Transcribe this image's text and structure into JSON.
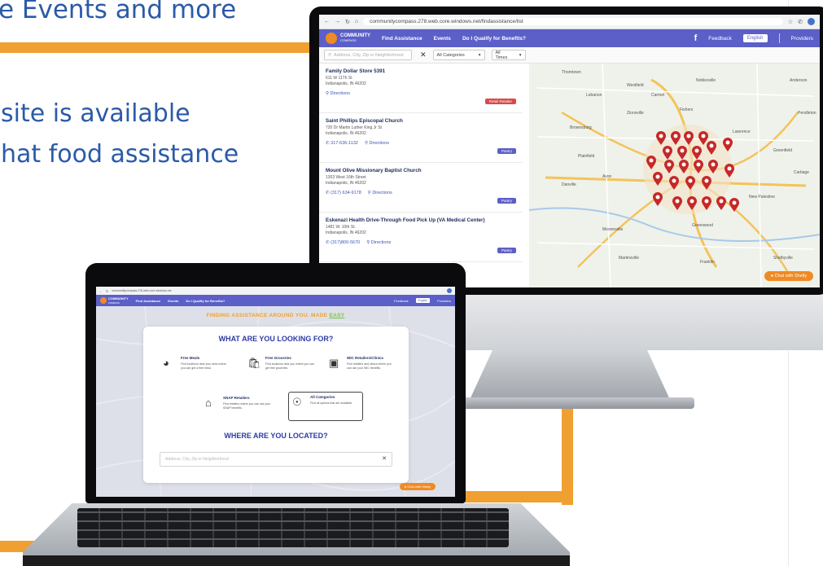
{
  "headline": {
    "line1": "e Events and more",
    "line2": "site is available",
    "line3": "hat food assistance"
  },
  "desktop": {
    "browser": {
      "url": "communitycompass.278.web.core.windows.net/findassistance/list"
    },
    "nav": {
      "logo_line1": "COMMUNITY",
      "logo_line2": "COMPASS",
      "links": [
        "Find Assistance",
        "Events",
        "Do I Qualify for Benefits?"
      ],
      "feedback": "Feedback",
      "language": "English",
      "providers": "Providers"
    },
    "filters": {
      "search_placeholder": "Address, City, Zip or Neighborhood",
      "category": "All Categories",
      "times": "All Times"
    },
    "results": [
      {
        "name": "Family Dollar Store 5391",
        "addr1": "611 W 11Th St",
        "addr2": "Indianapolis, IN 46202",
        "phone": "",
        "directions": "Directions",
        "tag": "Retail Retailer",
        "tag_color": "#d84a4a"
      },
      {
        "name": "Saint Phillips Episcopal Church",
        "addr1": "720 Dr Martin Luther King Jr St",
        "addr2": "Indianapolis, IN 46202",
        "phone": "317-636-1132",
        "directions": "Directions",
        "tag": "Pantry",
        "tag_color": "#5b5fc7"
      },
      {
        "name": "Mount Olive Missionary Baptist Church",
        "addr1": "1303 West 16th Street",
        "addr2": "Indianapolis, IN 46202",
        "phone": "(317) 634-9178",
        "directions": "Directions",
        "tag": "Pantry",
        "tag_color": "#5b5fc7"
      },
      {
        "name": "Eskenazi Health Drive-Through Food Pick Up (VA Medical Center)",
        "addr1": "1481 W. 10th St.",
        "addr2": "Indianapolis, IN 46202",
        "phone": "(317)800-5670",
        "directions": "Directions",
        "tag": "Pantry",
        "tag_color": "#5b5fc7"
      }
    ],
    "map": {
      "towns": [
        "Thorntown",
        "Lebanon",
        "Zionsville",
        "Carmel",
        "Fishers",
        "Noblesville",
        "Westfield",
        "Lawrence",
        "Greenfield",
        "Plainfield",
        "Greenwood",
        "Brownsburg",
        "Danville",
        "Avon",
        "Mooresville",
        "Martinsville",
        "Franklin",
        "Shelbyville",
        "Cartiage",
        "New Palestine",
        "Anderson",
        "Pendleton"
      ],
      "chat_label": "Chat with Shelly"
    }
  },
  "laptop": {
    "browser": {
      "url": "communitycompass.278.web.core.windows.net"
    },
    "nav": {
      "logo_line1": "COMMUNITY",
      "logo_line2": "COMPASS",
      "links": [
        "Find Assistance",
        "Events",
        "Do I Qualify for Benefits?"
      ],
      "feedback": "Feedback",
      "language": "English",
      "providers": "Providers"
    },
    "tagline_main": "FINDING ASSISTANCE AROUND YOU. MADE ",
    "tagline_easy": "EASY",
    "heading": "WHAT ARE YOU LOOKING FOR?",
    "options": [
      {
        "title": "Free Meals",
        "desc": "Find locations near your area where you can get a free meal.",
        "icon": "bowl-icon"
      },
      {
        "title": "Free Groceries",
        "desc": "Find locations near you where you can get free groceries.",
        "icon": "bag-icon"
      },
      {
        "title": "WIC Retailers/Clinics",
        "desc": "Find retailers and clinics where you can use your WIC benefits.",
        "icon": "store-icon"
      },
      {
        "title": "SNAP Retailers",
        "desc": "Find retailers where you can use your SNAP benefits.",
        "icon": "house-icon"
      },
      {
        "title": "All Categories",
        "desc": "Find all options that are available.",
        "icon": "compass-icon"
      }
    ],
    "heading2_a": "WHERE ",
    "heading2_b": "ARE YOU LOCATED?",
    "location_placeholder": "Address, City, Zip or Neighborhood",
    "chat_label": "Chat with Shelly"
  },
  "colors": {
    "brand": "#5b5fc7",
    "accent": "#f08a24",
    "headline": "#2b5aa8",
    "pin": "#c62828"
  }
}
